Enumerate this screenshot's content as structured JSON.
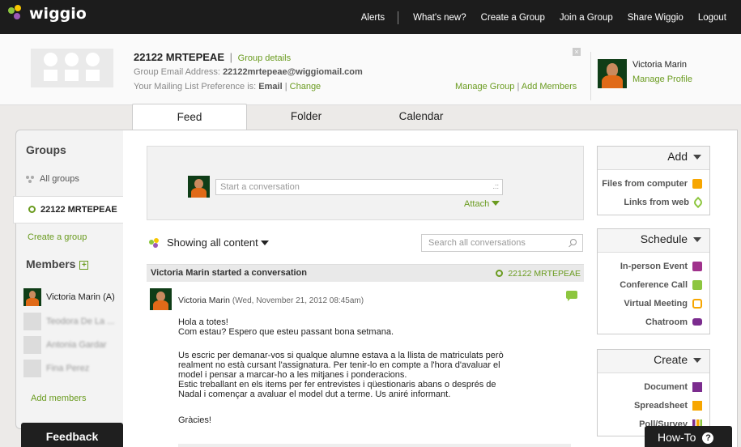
{
  "app": {
    "logo_text": "wiggio"
  },
  "nav": {
    "alerts": "Alerts",
    "whats_new": "What's new?",
    "create_group": "Create a Group",
    "join_group": "Join a Group",
    "share": "Share Wiggio",
    "logout": "Logout"
  },
  "group": {
    "name": "22122 MRTEPEAE",
    "separator": "|",
    "details_link": "Group details",
    "email_label": "Group Email Address:",
    "email": "22122mrtepeae@wiggiomail.com",
    "pref_label": "Your Mailing List Preference is:",
    "pref_value": "Email",
    "pref_sep": "|",
    "pref_change": "Change",
    "manage": "Manage Group",
    "manage_sep": "|",
    "add_members": "Add Members"
  },
  "user": {
    "name": "Victoria Marin",
    "manage_profile": "Manage Profile"
  },
  "tabs": [
    "Feed",
    "Folder",
    "Calendar"
  ],
  "sidebar": {
    "groups_heading": "Groups",
    "all_groups": "All groups",
    "selected_group": "22122 MRTEPEAE",
    "create_group": "Create a group",
    "members_heading": "Members",
    "members": [
      "Victoria Marin (A)",
      "Teodora De La ...",
      "Antonia Gardar",
      "Fina Perez"
    ],
    "add_members": "Add members"
  },
  "compose": {
    "placeholder": "Start a conversation",
    "resize_glyph": ".::",
    "attach": "Attach"
  },
  "filter": {
    "label": "Showing all content",
    "search_placeholder": "Search all conversations"
  },
  "conversation": {
    "header": "Victoria Marin started a conversation",
    "group_tag": "22122 MRTEPEAE",
    "author": "Victoria Marin",
    "date": "(Wed, November 21, 2012 08:45am)",
    "body_lines": [
      "Hola a totes!",
      "Com estau? Espero que esteu passant bona setmana.",
      "",
      "Us escric per demanar-vos si qualque alumne estava a la llista de matriculats però",
      "realment no està cursant l'assignatura. Per tenir-lo en compte a l'hora d'avaluar el",
      "model i pensar a marcar-ho a les mitjanes i ponderacions.",
      "Estic treballant en els items per fer entrevistes i qüestionaris abans o després de",
      "Nadal i començar a avaluar el model dut a terme. Us aniré informant.",
      "",
      "Gràcies!"
    ]
  },
  "panels": {
    "add": {
      "title": "Add",
      "items": [
        {
          "label": "Files from computer",
          "icon": "upload-icon",
          "color": "#f7a600"
        },
        {
          "label": "Links from web",
          "icon": "link-icon",
          "color": "#8dc63f"
        }
      ]
    },
    "schedule": {
      "title": "Schedule",
      "items": [
        {
          "label": "In-person Event",
          "icon": "calendar-icon",
          "color": "#a0328c"
        },
        {
          "label": "Conference Call",
          "icon": "phone-icon",
          "color": "#8dc63f"
        },
        {
          "label": "Virtual Meeting",
          "icon": "meeting-icon",
          "color": "#f7a600"
        },
        {
          "label": "Chatroom",
          "icon": "chat-icon",
          "color": "#7b2c8e"
        }
      ]
    },
    "create": {
      "title": "Create",
      "items": [
        {
          "label": "Document",
          "icon": "document-icon",
          "color": "#7b2c8e"
        },
        {
          "label": "Spreadsheet",
          "icon": "spreadsheet-icon",
          "color": "#f7a600"
        },
        {
          "label": "Poll/Survey",
          "icon": "poll-icon",
          "color": "#7b2c8e"
        }
      ]
    }
  },
  "footer": {
    "feedback": "Feedback",
    "howto": "How-To",
    "howto_icon": "?"
  },
  "colors": {
    "accent": "#6a9b1f",
    "topbar": "#1c1c1c",
    "logo_dot_green": "#8dc63f",
    "logo_dot_yellow": "#f7c600",
    "logo_dot_purple": "#9b59b6"
  }
}
